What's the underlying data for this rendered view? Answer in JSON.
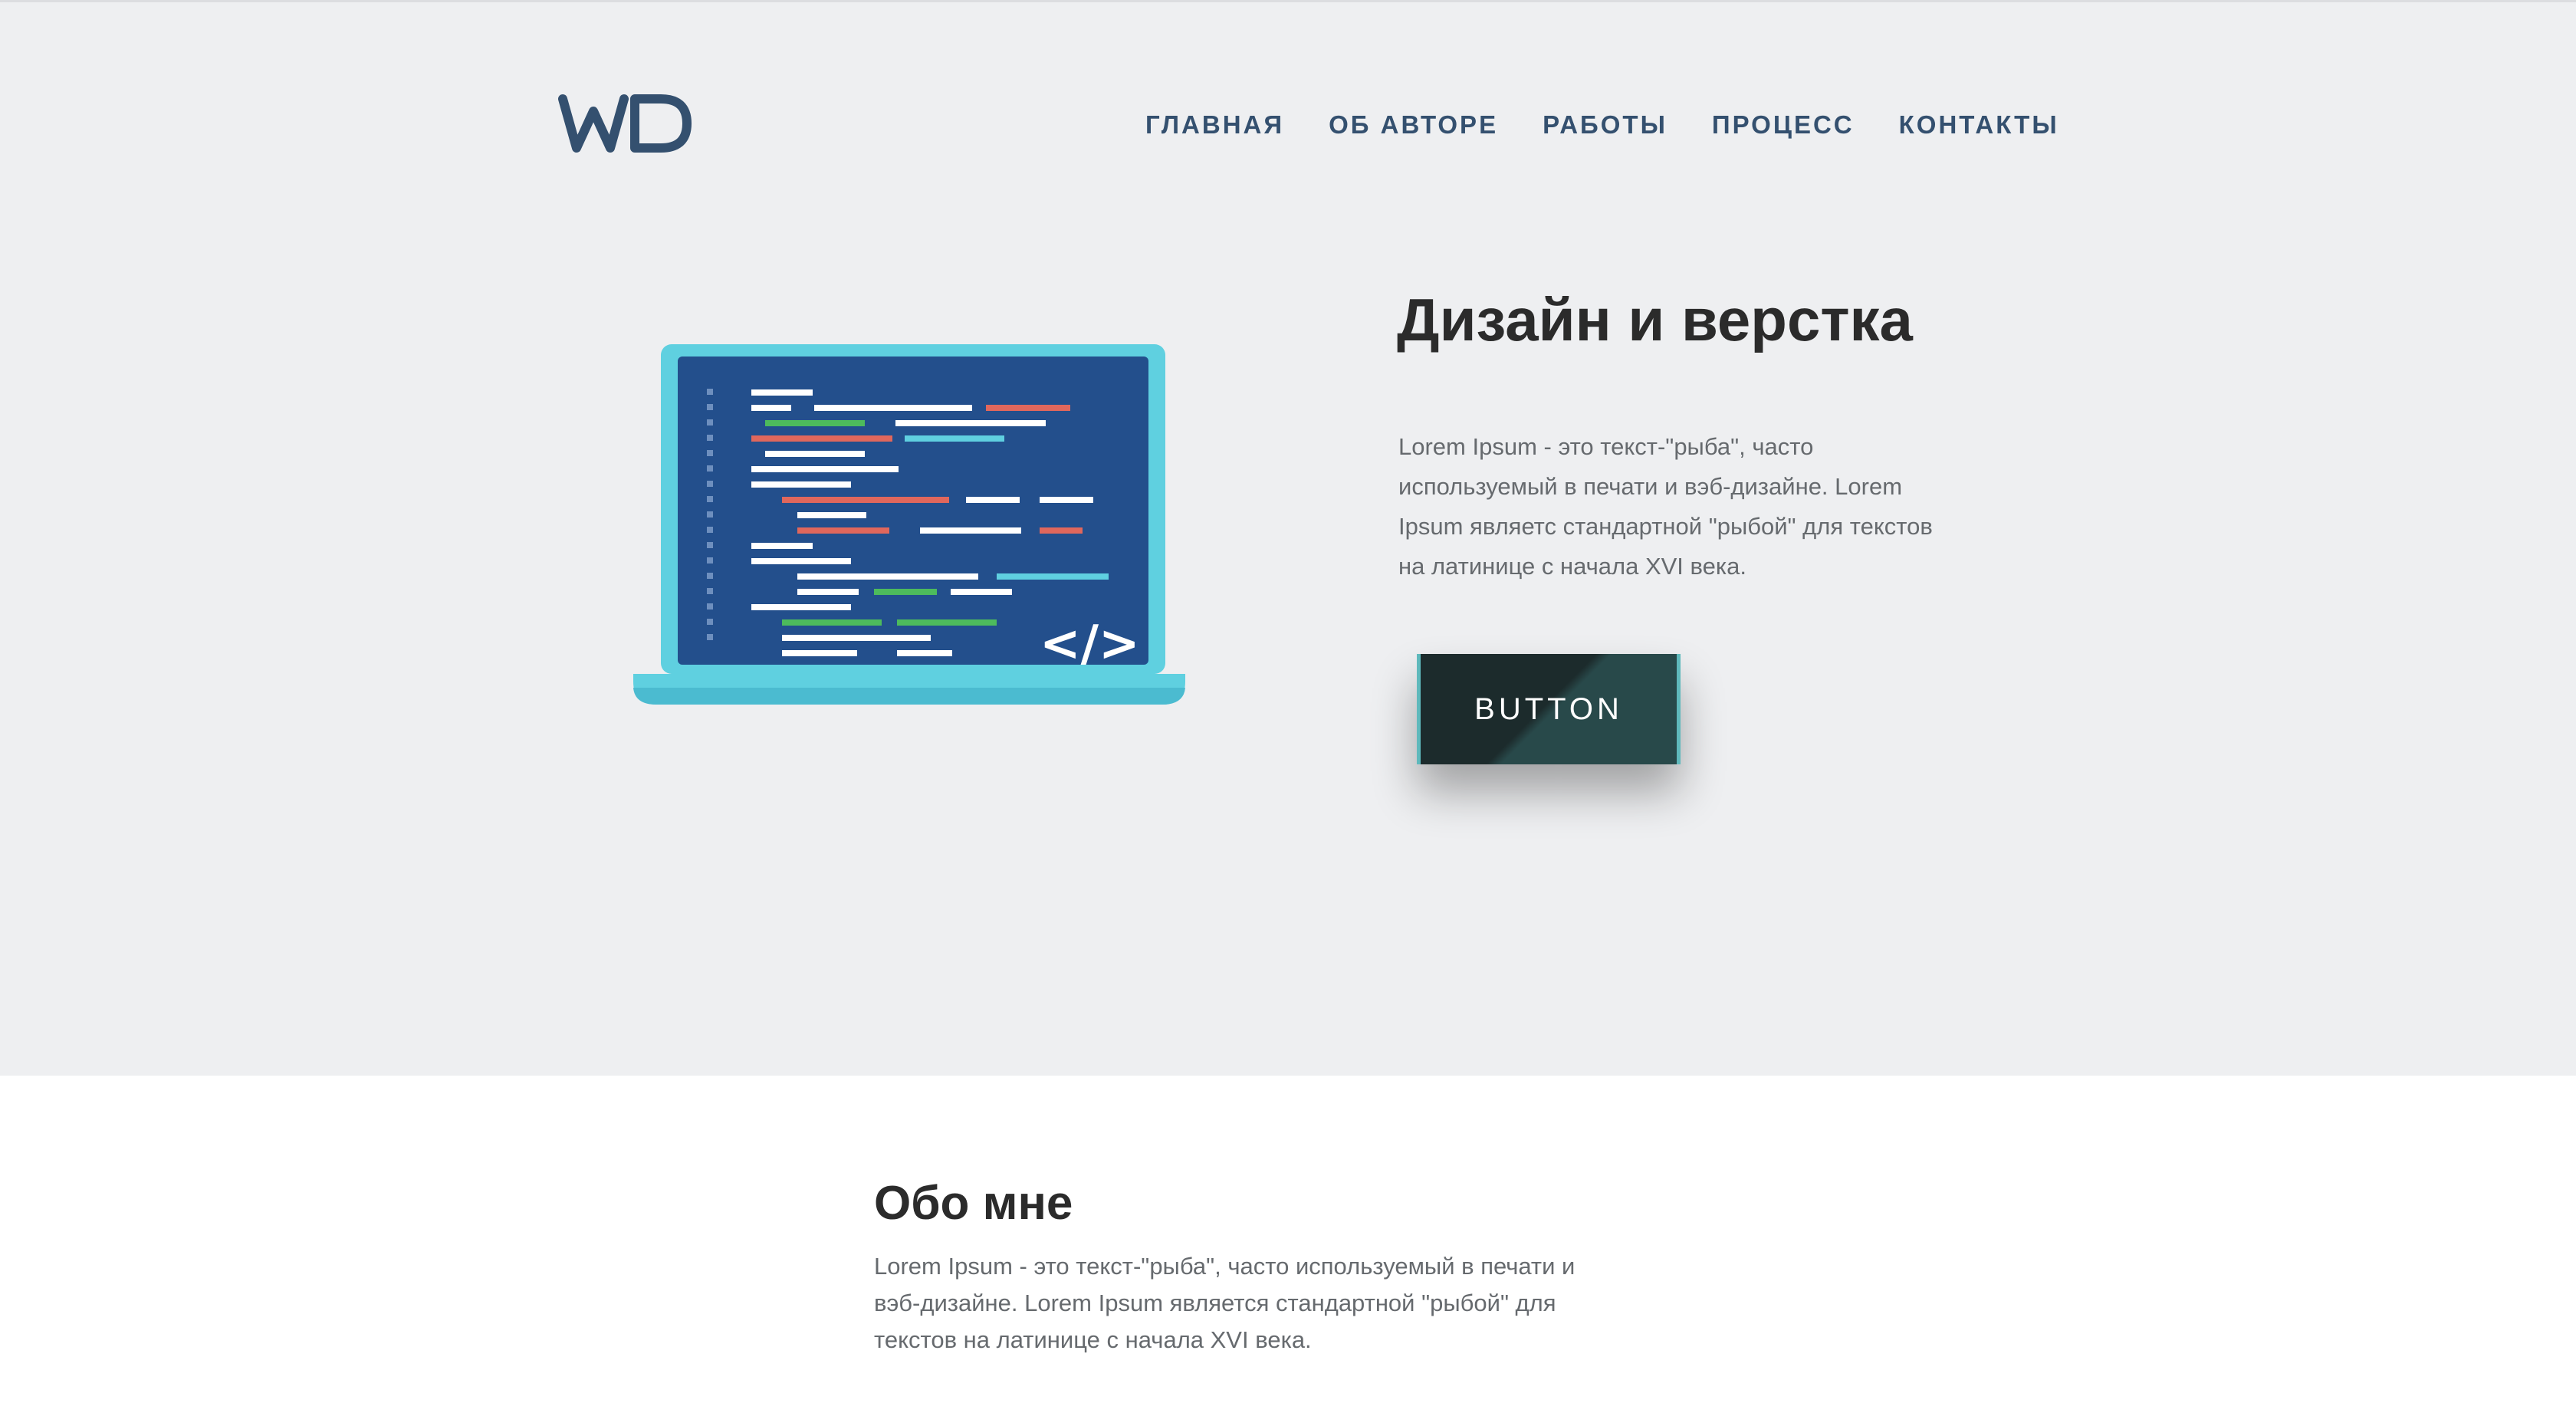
{
  "header": {
    "logo_text": "WD",
    "nav": [
      "ГЛАВНАЯ",
      "ОБ АВТОРЕ",
      "РАБОТЫ",
      "ПРОЦЕСС",
      "КОНТАКТЫ"
    ]
  },
  "hero": {
    "title": "Дизайн и верстка",
    "text": "Lorem Ipsum - это текст-\"рыба\", часто используемый в печати и вэб-дизайне. Lorem Ipsum являетс стандартной \"рыбой\" для текстов на латинице с начала XVI века.",
    "button_label": "BUTTON",
    "illustration": {
      "icon": "laptop-code-icon",
      "code_symbol": "</>"
    }
  },
  "about": {
    "title": "Обо мне",
    "text": "Lorem Ipsum - это текст-\"рыба\", часто используемый в печати и вэб-дизайне. Lorem Ipsum является стандартной \"рыбой\" для текстов на латинице с начала XVI века."
  },
  "colors": {
    "nav": "#34506f",
    "hero_bg": "#eeeff1",
    "laptop_frame": "#5fd0e0",
    "laptop_screen": "#234f8c",
    "button_dark": "#1c2b2c",
    "button_accent": "#5fb9bc"
  }
}
